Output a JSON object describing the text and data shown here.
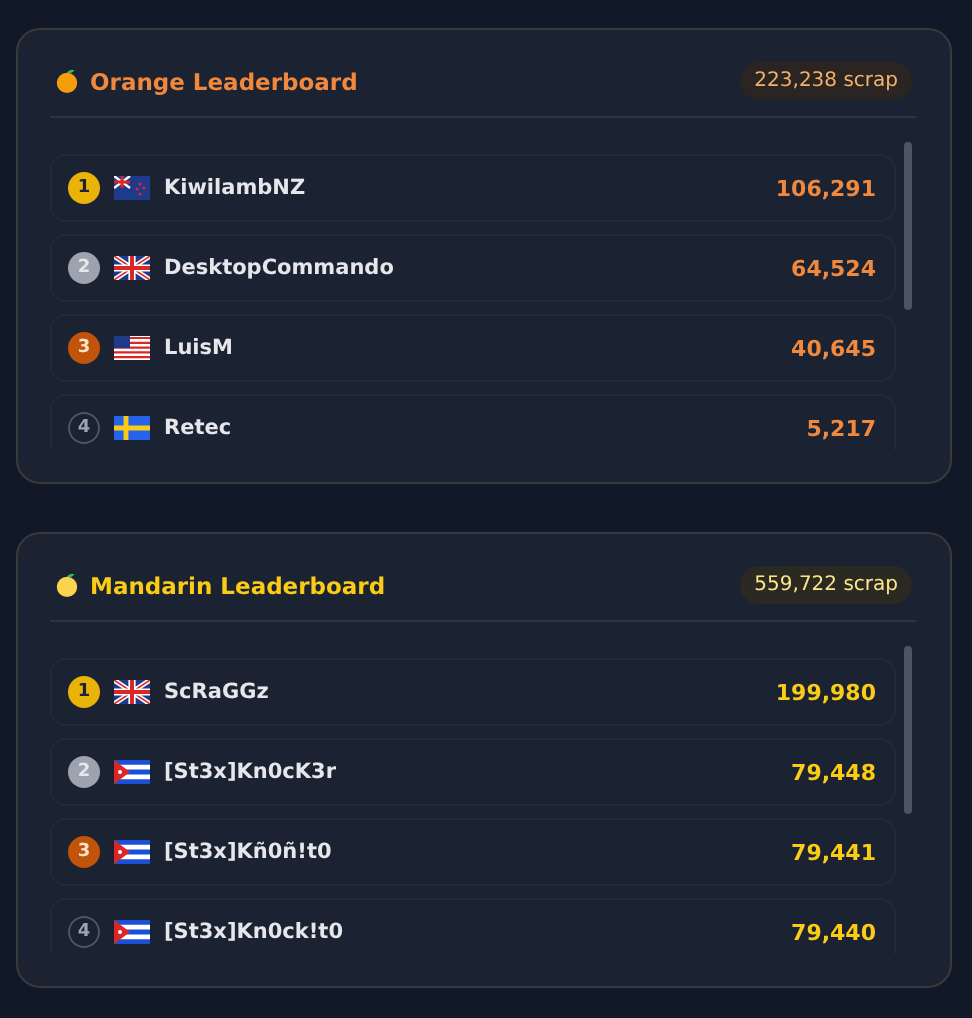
{
  "leaderboards": [
    {
      "title": "Orange Leaderboard",
      "color": "#f0883e",
      "icon": {
        "kind": "orange"
      },
      "total": "223,238 scrap",
      "players": [
        {
          "rank": {
            "text": "1",
            "kind": "gold"
          },
          "flag": {
            "kind": "nz"
          },
          "name": "KiwilambNZ",
          "score": "106,291"
        },
        {
          "rank": {
            "text": "2",
            "kind": "silver"
          },
          "flag": {
            "kind": "gb"
          },
          "name": "DesktopCommando",
          "score": "64,524"
        },
        {
          "rank": {
            "text": "3",
            "kind": "bronze"
          },
          "flag": {
            "kind": "us"
          },
          "name": "LuisM",
          "score": "40,645"
        },
        {
          "rank": {
            "text": "4",
            "kind": "plain"
          },
          "flag": {
            "kind": "se"
          },
          "name": "Retec",
          "score": "5,217"
        }
      ]
    },
    {
      "title": "Mandarin Leaderboard",
      "color": "#facc15",
      "icon": {
        "kind": "mandarin"
      },
      "total": "559,722 scrap",
      "players": [
        {
          "rank": {
            "text": "1",
            "kind": "gold"
          },
          "flag": {
            "kind": "gb"
          },
          "name": "ScRaGGz",
          "score": "199,980"
        },
        {
          "rank": {
            "text": "2",
            "kind": "silver"
          },
          "flag": {
            "kind": "cu"
          },
          "name": "[St3x]Kn0cK3r",
          "score": "79,448"
        },
        {
          "rank": {
            "text": "3",
            "kind": "bronze"
          },
          "flag": {
            "kind": "cu"
          },
          "name": "[St3x]Kñ0ñ!t0",
          "score": "79,441"
        },
        {
          "rank": {
            "text": "4",
            "kind": "plain"
          },
          "flag": {
            "kind": "cu"
          },
          "name": "[St3x]Kn0ck!t0",
          "score": "79,440"
        }
      ]
    }
  ]
}
